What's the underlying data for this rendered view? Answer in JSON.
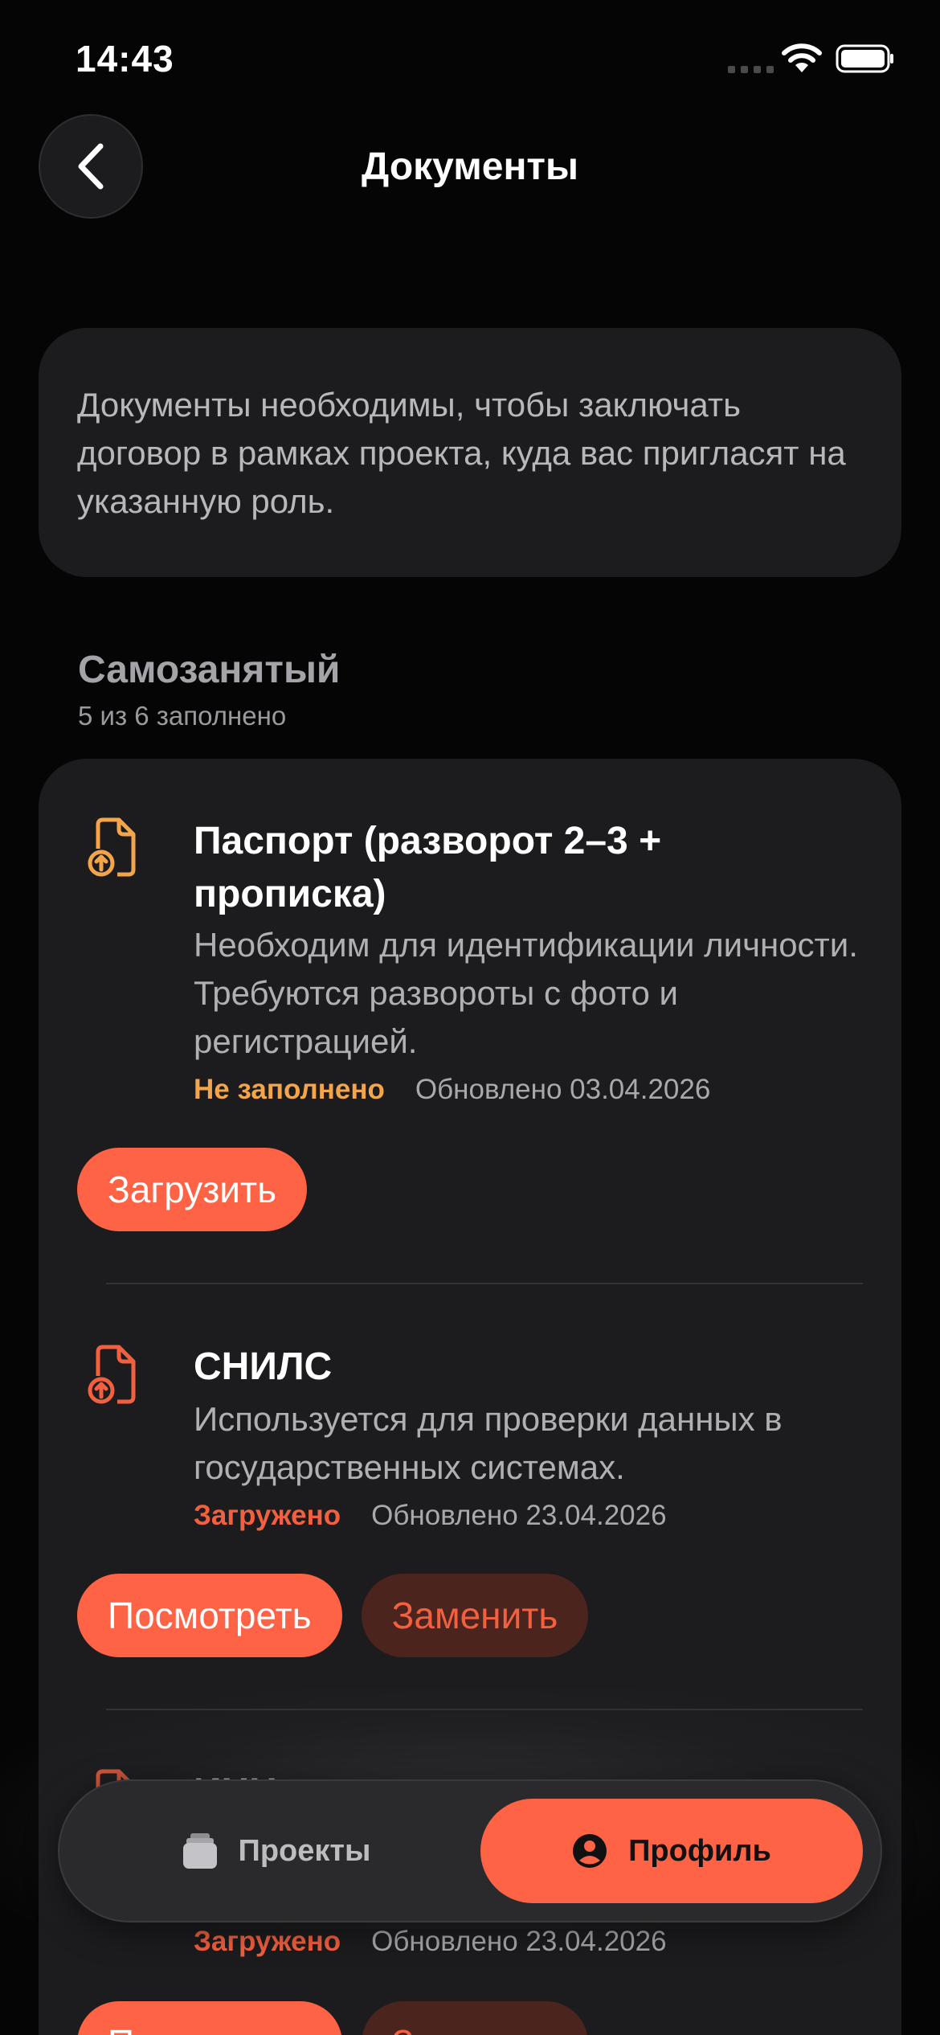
{
  "status_bar": {
    "time": "14:43"
  },
  "header": {
    "title": "Документы"
  },
  "info": {
    "text": "Документы необходимы, чтобы заключать договор в рамках проекта, куда вас пригласят на указанную роль."
  },
  "section": {
    "title": "Самозанятый",
    "subtitle": "5 из 6 заполнено"
  },
  "documents": [
    {
      "title": "Паспорт (разворот 2–3 + прописка)",
      "description": "Необходим для идентификации личности. Требуются развороты с фото и регистрацией.",
      "status": "Не заполнено",
      "updated": "Обновлено 03.04.2026",
      "primary_action": "Загрузить"
    },
    {
      "title": "СНИЛС",
      "description": "Используется для проверки данных в государственных системах.",
      "status": "Загружено",
      "updated": "Обновлено 23.04.2026",
      "primary_action": "Посмотреть",
      "secondary_action": "Заменить"
    },
    {
      "title": "ИНН",
      "status": "Загружено",
      "updated": "Обновлено 23.04.2026",
      "primary_action": "Посмотреть",
      "secondary_action": "Заменить"
    }
  ],
  "tabs": {
    "projects": "Проекты",
    "profile": "Профиль"
  },
  "colors": {
    "accent": "#fe6345",
    "warning": "#f4a54a",
    "card": "#1c1c1e"
  }
}
